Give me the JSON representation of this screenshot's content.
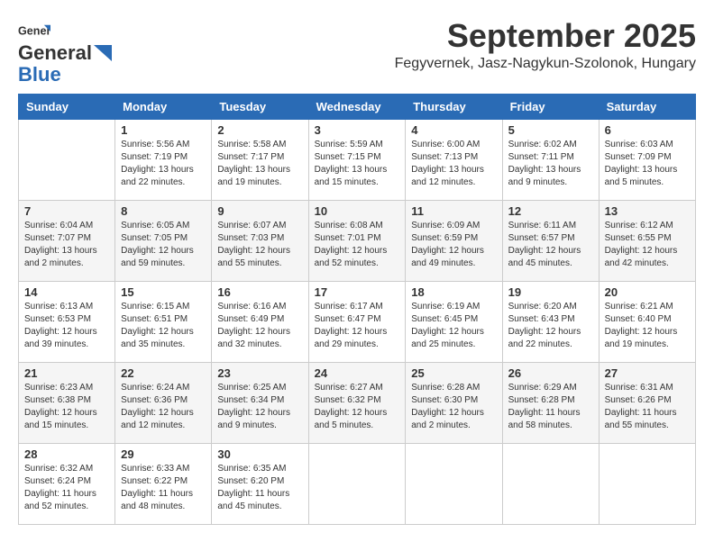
{
  "header": {
    "logo_general": "General",
    "logo_blue": "Blue",
    "title": "September 2025",
    "subtitle": "Fegyvernek, Jasz-Nagykun-Szolonok, Hungary"
  },
  "days_of_week": [
    "Sunday",
    "Monday",
    "Tuesday",
    "Wednesday",
    "Thursday",
    "Friday",
    "Saturday"
  ],
  "weeks": [
    {
      "days": [
        {
          "number": "",
          "info": ""
        },
        {
          "number": "1",
          "info": "Sunrise: 5:56 AM\nSunset: 7:19 PM\nDaylight: 13 hours\nand 22 minutes."
        },
        {
          "number": "2",
          "info": "Sunrise: 5:58 AM\nSunset: 7:17 PM\nDaylight: 13 hours\nand 19 minutes."
        },
        {
          "number": "3",
          "info": "Sunrise: 5:59 AM\nSunset: 7:15 PM\nDaylight: 13 hours\nand 15 minutes."
        },
        {
          "number": "4",
          "info": "Sunrise: 6:00 AM\nSunset: 7:13 PM\nDaylight: 13 hours\nand 12 minutes."
        },
        {
          "number": "5",
          "info": "Sunrise: 6:02 AM\nSunset: 7:11 PM\nDaylight: 13 hours\nand 9 minutes."
        },
        {
          "number": "6",
          "info": "Sunrise: 6:03 AM\nSunset: 7:09 PM\nDaylight: 13 hours\nand 5 minutes."
        }
      ]
    },
    {
      "days": [
        {
          "number": "7",
          "info": "Sunrise: 6:04 AM\nSunset: 7:07 PM\nDaylight: 13 hours\nand 2 minutes."
        },
        {
          "number": "8",
          "info": "Sunrise: 6:05 AM\nSunset: 7:05 PM\nDaylight: 12 hours\nand 59 minutes."
        },
        {
          "number": "9",
          "info": "Sunrise: 6:07 AM\nSunset: 7:03 PM\nDaylight: 12 hours\nand 55 minutes."
        },
        {
          "number": "10",
          "info": "Sunrise: 6:08 AM\nSunset: 7:01 PM\nDaylight: 12 hours\nand 52 minutes."
        },
        {
          "number": "11",
          "info": "Sunrise: 6:09 AM\nSunset: 6:59 PM\nDaylight: 12 hours\nand 49 minutes."
        },
        {
          "number": "12",
          "info": "Sunrise: 6:11 AM\nSunset: 6:57 PM\nDaylight: 12 hours\nand 45 minutes."
        },
        {
          "number": "13",
          "info": "Sunrise: 6:12 AM\nSunset: 6:55 PM\nDaylight: 12 hours\nand 42 minutes."
        }
      ]
    },
    {
      "days": [
        {
          "number": "14",
          "info": "Sunrise: 6:13 AM\nSunset: 6:53 PM\nDaylight: 12 hours\nand 39 minutes."
        },
        {
          "number": "15",
          "info": "Sunrise: 6:15 AM\nSunset: 6:51 PM\nDaylight: 12 hours\nand 35 minutes."
        },
        {
          "number": "16",
          "info": "Sunrise: 6:16 AM\nSunset: 6:49 PM\nDaylight: 12 hours\nand 32 minutes."
        },
        {
          "number": "17",
          "info": "Sunrise: 6:17 AM\nSunset: 6:47 PM\nDaylight: 12 hours\nand 29 minutes."
        },
        {
          "number": "18",
          "info": "Sunrise: 6:19 AM\nSunset: 6:45 PM\nDaylight: 12 hours\nand 25 minutes."
        },
        {
          "number": "19",
          "info": "Sunrise: 6:20 AM\nSunset: 6:43 PM\nDaylight: 12 hours\nand 22 minutes."
        },
        {
          "number": "20",
          "info": "Sunrise: 6:21 AM\nSunset: 6:40 PM\nDaylight: 12 hours\nand 19 minutes."
        }
      ]
    },
    {
      "days": [
        {
          "number": "21",
          "info": "Sunrise: 6:23 AM\nSunset: 6:38 PM\nDaylight: 12 hours\nand 15 minutes."
        },
        {
          "number": "22",
          "info": "Sunrise: 6:24 AM\nSunset: 6:36 PM\nDaylight: 12 hours\nand 12 minutes."
        },
        {
          "number": "23",
          "info": "Sunrise: 6:25 AM\nSunset: 6:34 PM\nDaylight: 12 hours\nand 9 minutes."
        },
        {
          "number": "24",
          "info": "Sunrise: 6:27 AM\nSunset: 6:32 PM\nDaylight: 12 hours\nand 5 minutes."
        },
        {
          "number": "25",
          "info": "Sunrise: 6:28 AM\nSunset: 6:30 PM\nDaylight: 12 hours\nand 2 minutes."
        },
        {
          "number": "26",
          "info": "Sunrise: 6:29 AM\nSunset: 6:28 PM\nDaylight: 11 hours\nand 58 minutes."
        },
        {
          "number": "27",
          "info": "Sunrise: 6:31 AM\nSunset: 6:26 PM\nDaylight: 11 hours\nand 55 minutes."
        }
      ]
    },
    {
      "days": [
        {
          "number": "28",
          "info": "Sunrise: 6:32 AM\nSunset: 6:24 PM\nDaylight: 11 hours\nand 52 minutes."
        },
        {
          "number": "29",
          "info": "Sunrise: 6:33 AM\nSunset: 6:22 PM\nDaylight: 11 hours\nand 48 minutes."
        },
        {
          "number": "30",
          "info": "Sunrise: 6:35 AM\nSunset: 6:20 PM\nDaylight: 11 hours\nand 45 minutes."
        },
        {
          "number": "",
          "info": ""
        },
        {
          "number": "",
          "info": ""
        },
        {
          "number": "",
          "info": ""
        },
        {
          "number": "",
          "info": ""
        }
      ]
    }
  ]
}
